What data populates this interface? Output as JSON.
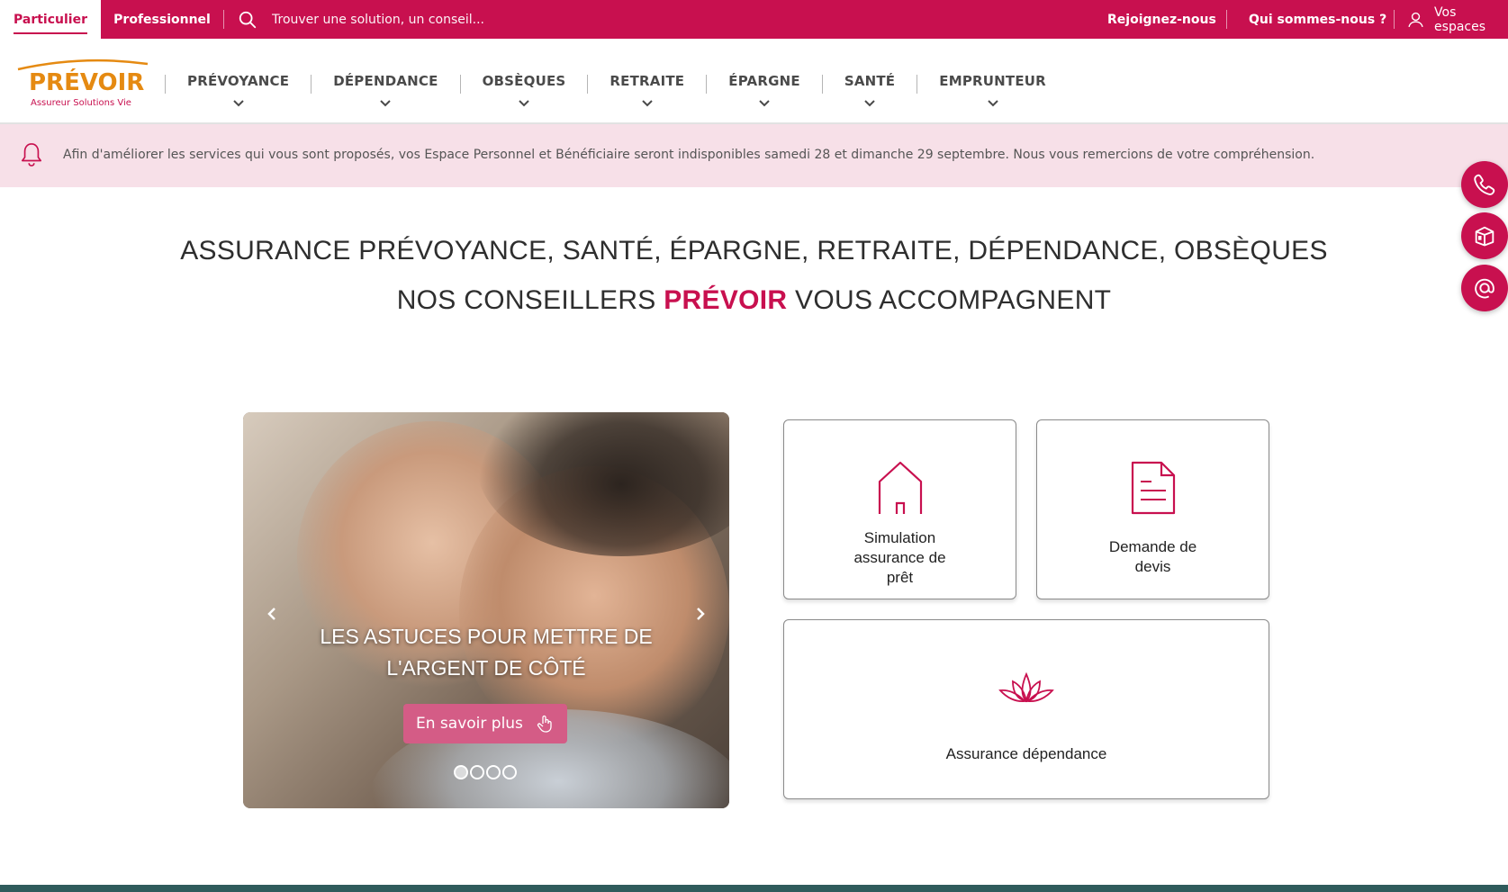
{
  "topbar": {
    "tab_particulier": "Particulier",
    "tab_professionnel": "Professionnel",
    "search_placeholder": "Trouver une solution, un conseil...",
    "rejoignez": "Rejoignez-nous",
    "qui_sommes": "Qui sommes-nous ?",
    "vos_espaces": "Vos espaces"
  },
  "logo": {
    "word": "PRÉVOIR",
    "subtitle": "Assureur Solutions Vie"
  },
  "nav": {
    "items": [
      "PRÉVOYANCE",
      "DÉPENDANCE",
      "OBSÈQUES",
      "RETRAITE",
      "ÉPARGNE",
      "SANTÉ",
      "EMPRUNTEUR"
    ]
  },
  "alert": {
    "text": "Afin d'améliorer les services qui vous sont proposés, vos Espace Personnel et Bénéficiaire seront indisponibles samedi 28 et dimanche 29 septembre. Nous vous remercions de votre compréhension."
  },
  "headline": {
    "line1": "ASSURANCE PRÉVOYANCE, SANTÉ, ÉPARGNE, RETRAITE, DÉPENDANCE, OBSÈQUES",
    "line2_pre": "NOS CONSEILLERS",
    "line2_accent": "PRÉVOIR",
    "line2_post": "VOUS ACCOMPAGNENT"
  },
  "carousel": {
    "title_line1": "LES ASTUCES POUR METTRE DE",
    "title_line2": "L'ARGENT DE CÔTÉ",
    "cta": "En savoir plus"
  },
  "cards": {
    "simulation": [
      "Simulation",
      "assurance de",
      "prêt"
    ],
    "devis": [
      "Demande de",
      "devis"
    ],
    "dependance": "Assurance dépendance"
  },
  "colors": {
    "brand": "#c8104f",
    "logo_orange": "#e58a12",
    "alert_bg": "#f7e0e8",
    "cta": "#d45c86"
  },
  "icons": {
    "search": "search-icon",
    "user": "user-icon",
    "bell": "bell-icon",
    "phone": "phone-icon",
    "shop": "shop-icon",
    "email": "at-sign-icon",
    "house": "house-icon",
    "document": "document-icon",
    "lotus": "lotus-icon"
  }
}
